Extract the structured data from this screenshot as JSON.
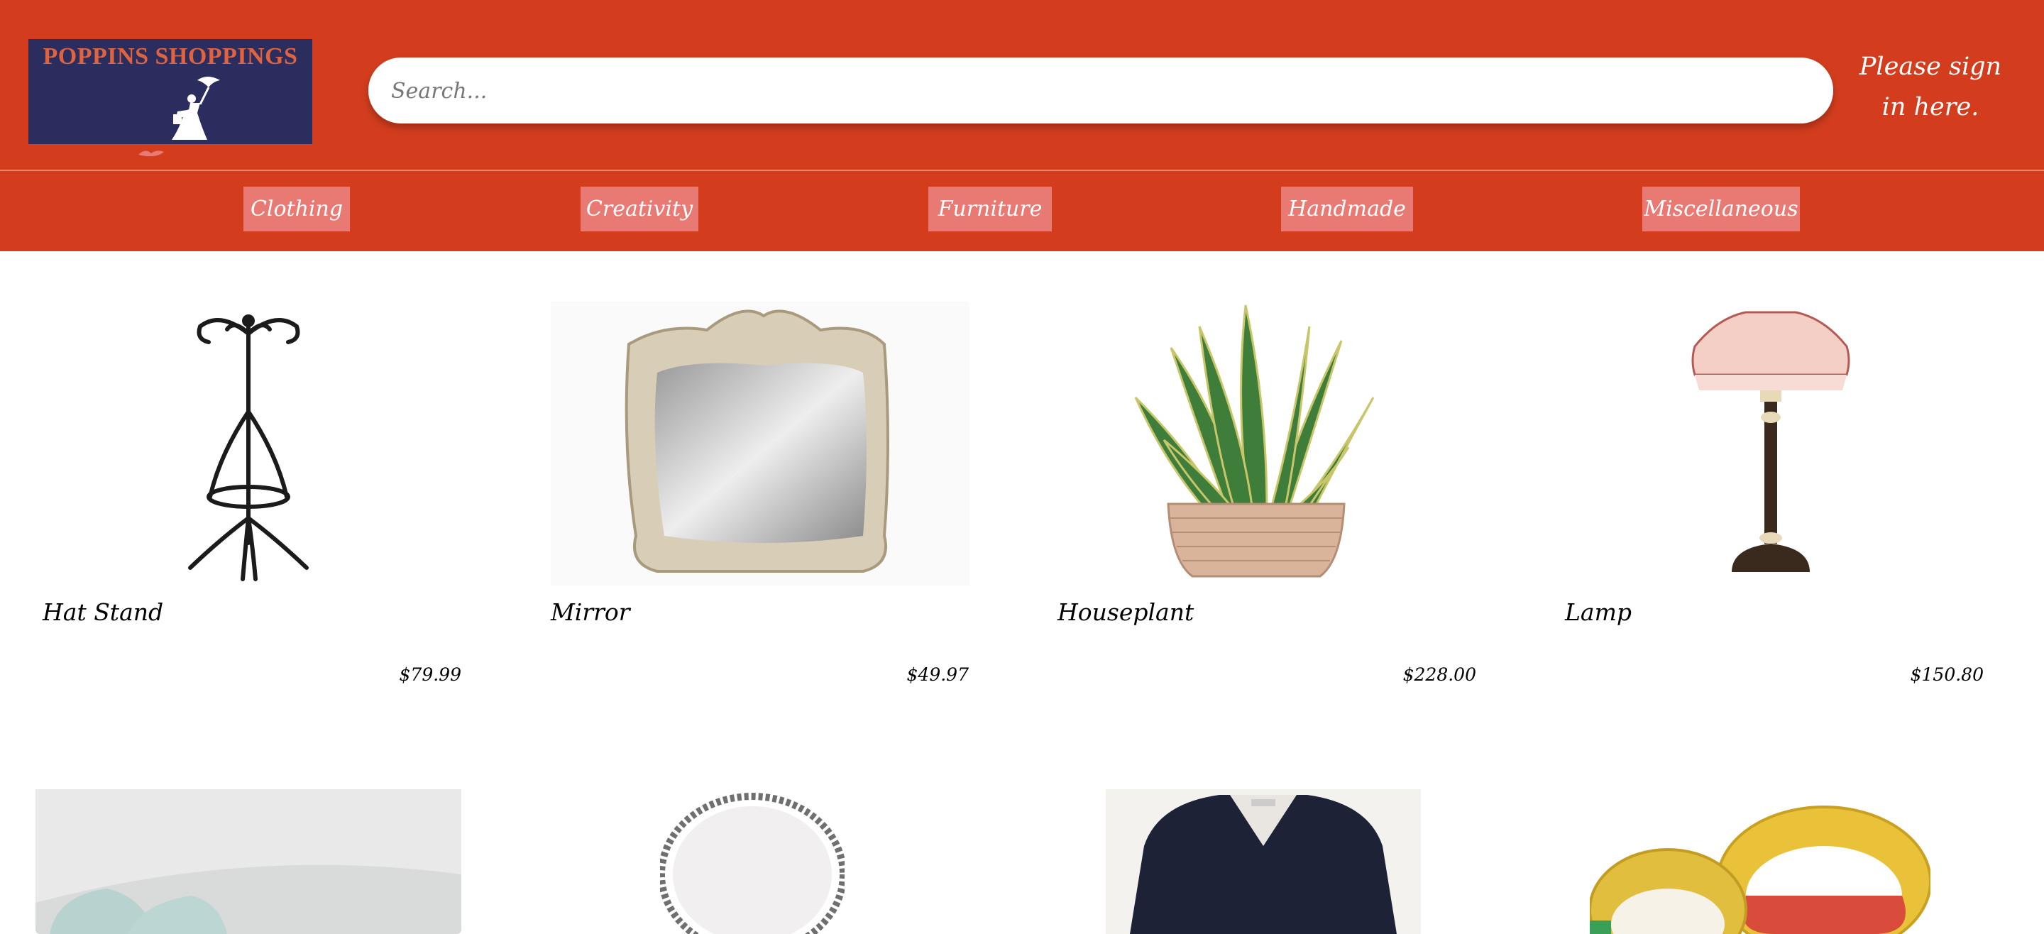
{
  "brand": {
    "name": "POPPINS SHOPPINGS",
    "colors": {
      "header": "#d33d1e",
      "logo_bg": "#2a2d5e",
      "logo_text": "#e0633f",
      "nav_button": "#e87a73"
    }
  },
  "search": {
    "placeholder": "Search..."
  },
  "account": {
    "signin_label": "Please sign in here."
  },
  "categories": [
    "Clothing",
    "Creativity",
    "Furniture",
    "Handmade",
    "Miscellaneous"
  ],
  "products": [
    {
      "name": "Hat Stand",
      "price": "$79.99",
      "image": "hat-stand-image"
    },
    {
      "name": "Mirror",
      "price": "$49.97",
      "image": "mirror-image"
    },
    {
      "name": "Houseplant",
      "price": "$228.00",
      "image": "houseplant-image"
    },
    {
      "name": "Lamp",
      "price": "$150.80",
      "image": "lamp-image"
    }
  ],
  "more_products": [
    {
      "image": "shoes-image"
    },
    {
      "image": "hand-mirror-image"
    },
    {
      "image": "blazer-image"
    },
    {
      "image": "tape-measure-image"
    }
  ]
}
